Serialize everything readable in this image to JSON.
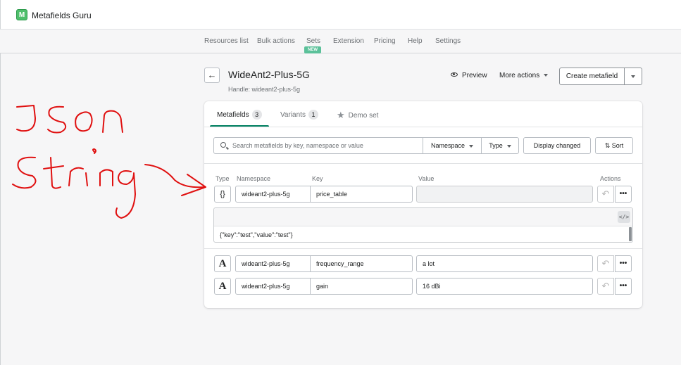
{
  "app": {
    "name": "Metafields Guru",
    "logo_letter": "M"
  },
  "nav": {
    "items": [
      "Resources list",
      "Bulk actions",
      "Sets",
      "Extension",
      "Pricing",
      "Help",
      "Settings"
    ],
    "new_badge": "NEW"
  },
  "header": {
    "back": "←",
    "title": "WideAnt2-Plus-5G",
    "handle": "Handle: wideant2-plus-5g",
    "preview": "Preview",
    "more_actions": "More actions",
    "create": "Create metafield"
  },
  "tabs": [
    {
      "label": "Metafields",
      "count": "3"
    },
    {
      "label": "Variants",
      "count": "1"
    },
    {
      "label": "Demo set"
    }
  ],
  "filters": {
    "search_placeholder": "Search metafields by key, namespace or value",
    "namespace": "Namespace",
    "type": "Type",
    "display_changed": "Display changed",
    "sort": "Sort"
  },
  "columns": {
    "type": "Type",
    "namespace": "Namespace",
    "key": "Key",
    "value": "Value",
    "actions": "Actions"
  },
  "rows": [
    {
      "type_icon": "{}",
      "namespace": "wideant2-plus-5g",
      "key": "price_table",
      "value": "",
      "json": "{\"key\":\"test\",\"value\":\"test\"}"
    },
    {
      "type_icon": "A",
      "namespace": "wideant2-plus-5g",
      "key": "frequency_range",
      "value": "a lot"
    },
    {
      "type_icon": "A",
      "namespace": "wideant2-plus-5g",
      "key": "gain",
      "value": "16 dBi"
    }
  ],
  "icons": {
    "code": "</>",
    "undo": "↶",
    "more": "•••",
    "star": "★",
    "sort": "⇅"
  },
  "annotation": {
    "color": "#e01010"
  }
}
